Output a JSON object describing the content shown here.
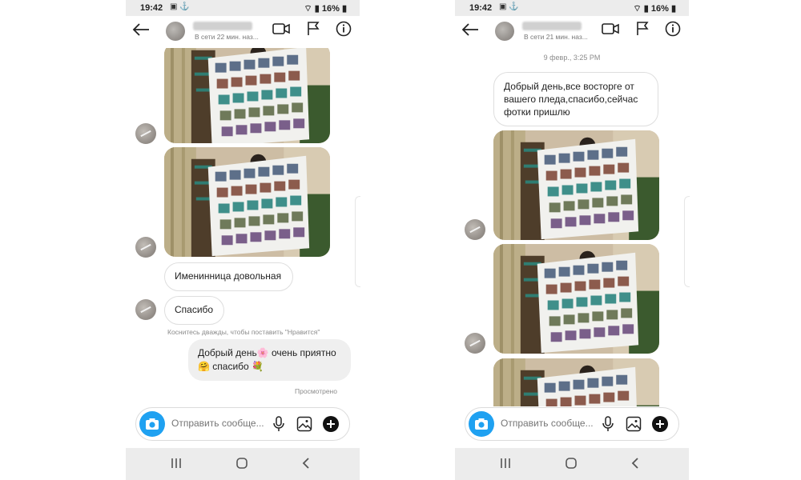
{
  "phones": [
    {
      "status_time": "19:42",
      "status_battery": "16%",
      "header_status": "В сети 22 мин. наз...",
      "messages": {
        "bubble_1": "Именинница довольная",
        "bubble_2": "Спасибо",
        "hint": "Коснитесь дважды, чтобы поставить \"Нравится\"",
        "out_line1": "Добрый день🌸 очень приятно",
        "out_line2": "🤗 спасибо 💐",
        "seen": "Просмотрено"
      },
      "composer_placeholder": "Отправить сообще..."
    },
    {
      "status_time": "19:42",
      "status_battery": "16%",
      "header_status": "В сети 21 мин. наз...",
      "messages": {
        "date": "9 февр., 3:25 PM",
        "bubble_1": "Добрый день,все восторге от вашего пледа,спасибо,сейчас фотки пришлю"
      },
      "composer_placeholder": "Отправить сообще..."
    }
  ],
  "icons": [
    "back-arrow-icon",
    "video-call-icon",
    "flag-icon",
    "info-icon",
    "camera-icon",
    "microphone-icon",
    "gallery-icon",
    "add-icon",
    "recent-apps-icon",
    "home-icon",
    "back-nav-icon"
  ],
  "colors": {
    "camera_accent": "#1fa1f1",
    "outgoing_bubble": "#efefef",
    "system_bar": "#ececec"
  }
}
